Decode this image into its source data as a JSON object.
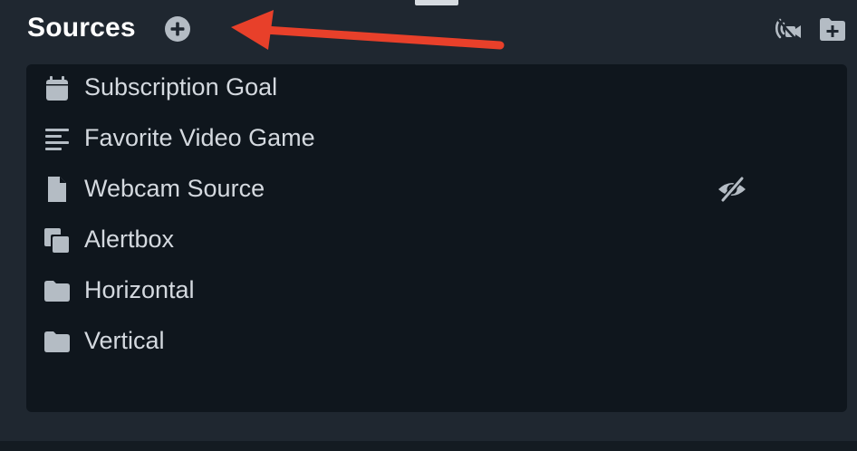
{
  "header": {
    "title": "Sources",
    "add_icon": "plus-circle-icon",
    "actions": [
      {
        "icon": "broadcast-camera-icon"
      },
      {
        "icon": "add-folder-icon"
      }
    ]
  },
  "annotation": {
    "type": "arrow",
    "color": "#e8402a",
    "points_to": "add-source-button"
  },
  "sources": [
    {
      "label": "Subscription Goal",
      "icon": "calendar-icon"
    },
    {
      "label": "Favorite Video Game",
      "icon": "text-lines-icon"
    },
    {
      "label": "Webcam Source",
      "icon": "file-icon",
      "hidden": true,
      "visibility_icon": "eye-slash-icon"
    },
    {
      "label": "Alertbox",
      "icon": "copy-icon"
    },
    {
      "label": "Horizontal",
      "icon": "folder-icon"
    },
    {
      "label": "Vertical",
      "icon": "folder-icon"
    }
  ],
  "colors": {
    "background": "#1f2730",
    "panel": "#0f161d",
    "text": "#d4d9df",
    "icon": "#b4bcc4",
    "title": "#ffffff"
  }
}
